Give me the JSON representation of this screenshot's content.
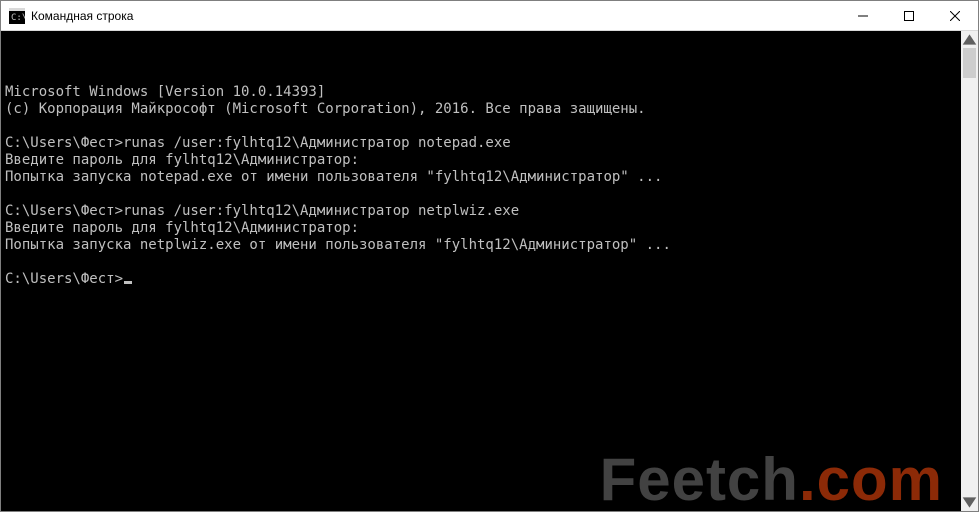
{
  "window": {
    "title": "Командная строка"
  },
  "terminal": {
    "lines": [
      "Microsoft Windows [Version 10.0.14393]",
      "(c) Корпорация Майкрософт (Microsoft Corporation), 2016. Все права защищены.",
      "",
      "C:\\Users\\Фест>runas /user:fylhtq12\\Администратор notepad.exe",
      "Введите пароль для fylhtq12\\Администратор:",
      "Попытка запуска notepad.exe от имени пользователя \"fylhtq12\\Администратор\" ...",
      "",
      "C:\\Users\\Фест>runas /user:fylhtq12\\Администратор netplwiz.exe",
      "Введите пароль для fylhtq12\\Администратор:",
      "Попытка запуска netplwiz.exe от имени пользователя \"fylhtq12\\Администратор\" ...",
      ""
    ],
    "prompt": "C:\\Users\\Фест>"
  },
  "watermark": {
    "brand": "Feetch",
    "dot": ".",
    "tld": "com"
  }
}
